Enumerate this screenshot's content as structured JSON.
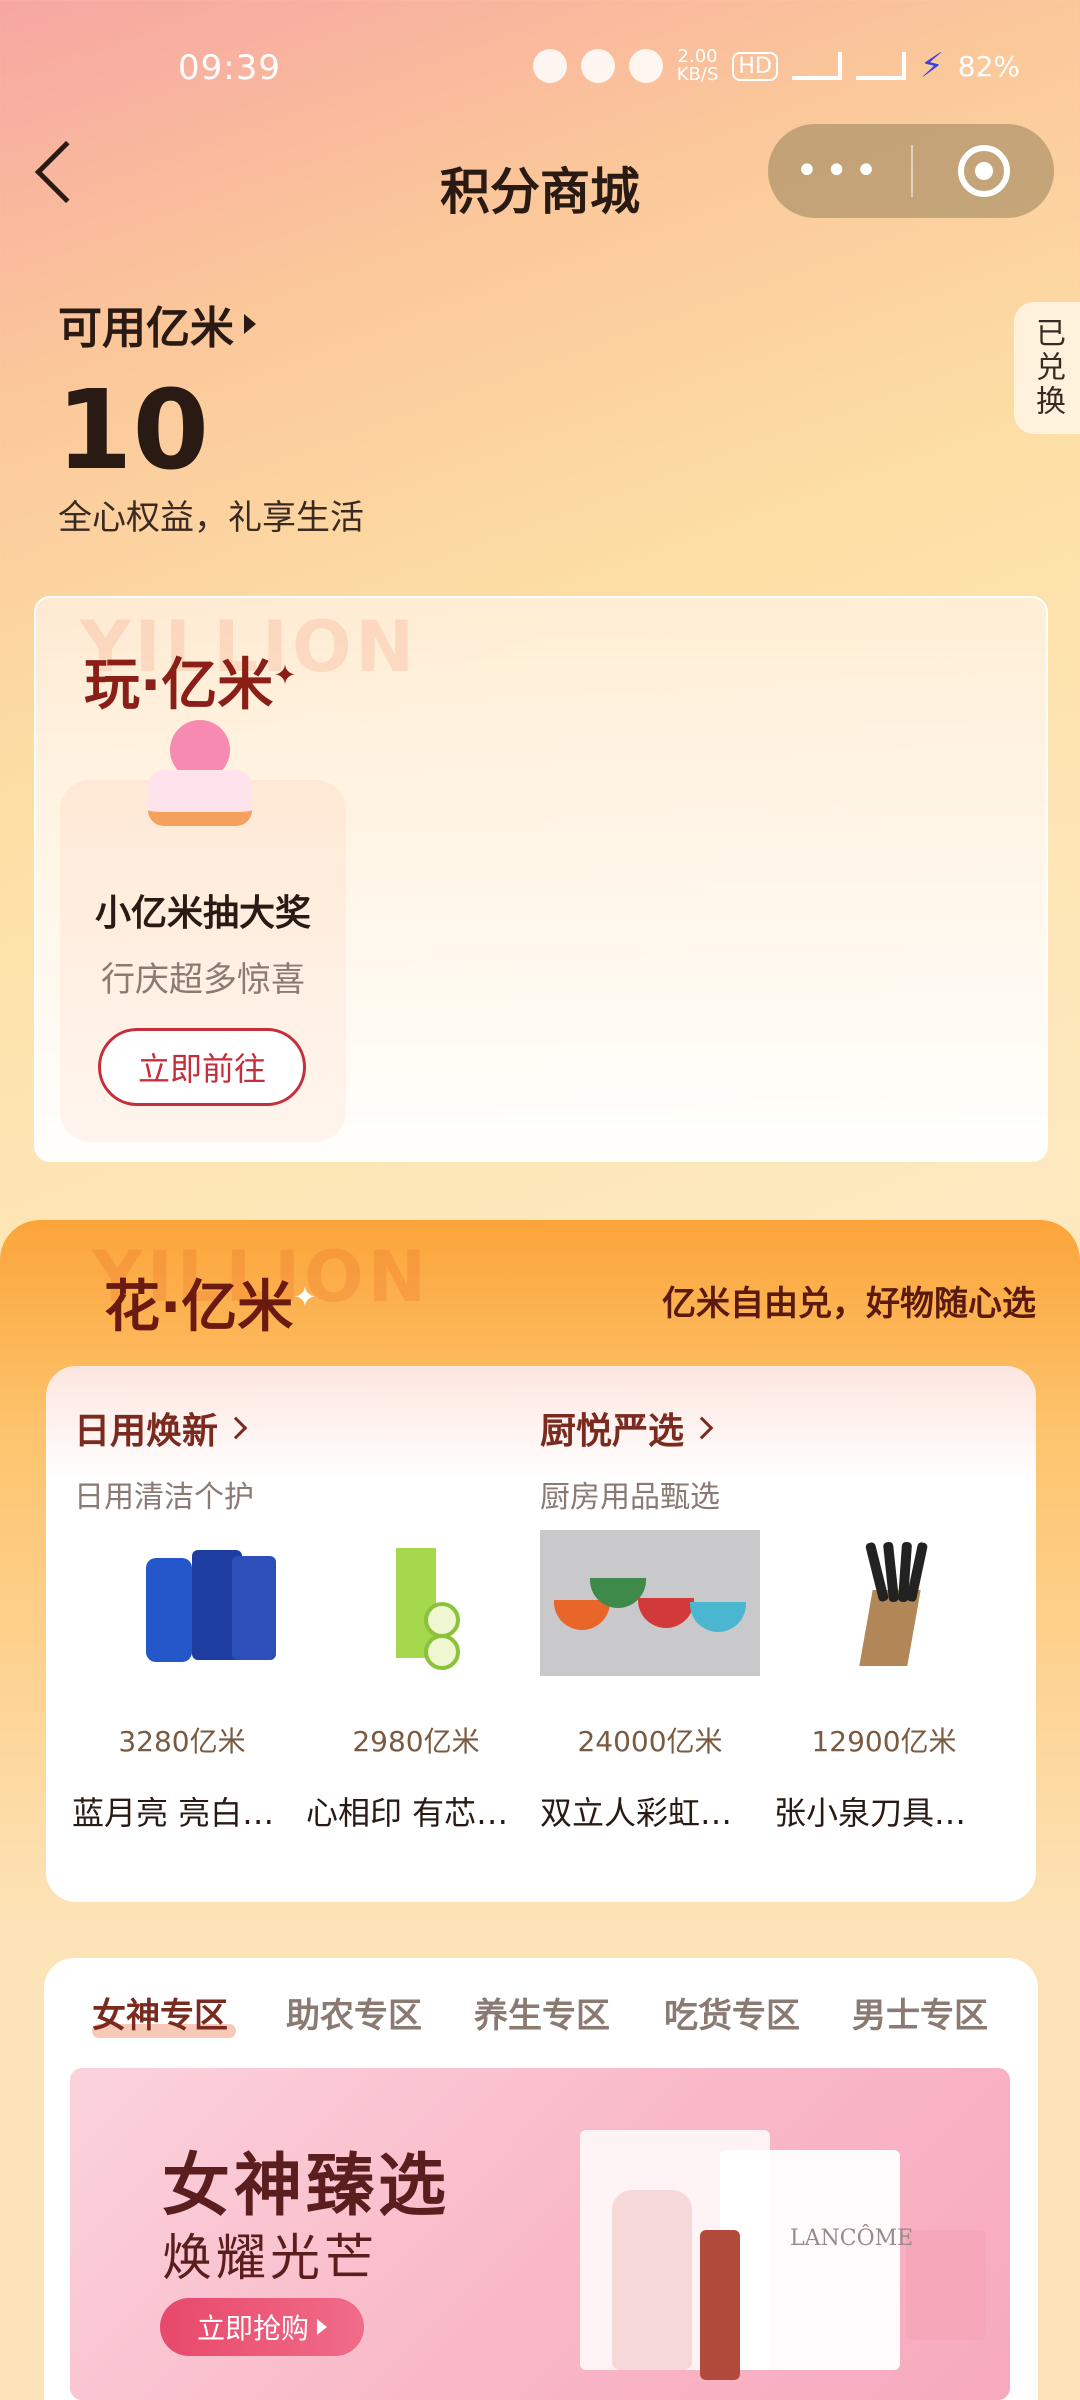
{
  "status_bar": {
    "time": "09:39",
    "speed": "2.00",
    "speed_unit": "KB/S",
    "hd": "HD",
    "battery": "82%"
  },
  "nav": {
    "title": "积分商城",
    "more_glyph": "•••"
  },
  "points": {
    "label": "可用亿米",
    "value": "10",
    "subtitle": "全心权益，礼享生活",
    "redeemed_tab": "已兑换"
  },
  "play_section": {
    "watermark": "YILLION",
    "title": "玩·亿米",
    "spark": "✦",
    "lottery": {
      "title": "小亿米抽大奖",
      "subtitle": "行庆超多惊喜",
      "button": "立即前往"
    }
  },
  "flower_section": {
    "watermark": "YILLION",
    "title": "花·亿米",
    "spark": "✦",
    "slogan": "亿米自由兑，好物随心选",
    "categories": [
      {
        "title": "日用焕新",
        "subtitle": "日用清洁个护"
      },
      {
        "title": "厨悦严选",
        "subtitle": "厨房用品甄选"
      }
    ],
    "products": [
      {
        "price": "3280亿米",
        "name": "蓝月亮 亮白…"
      },
      {
        "price": "2980亿米",
        "name": "心相印 有芯…"
      },
      {
        "price": "24000亿米",
        "name": "双立人彩虹…"
      },
      {
        "price": "12900亿米",
        "name": "张小泉刀具…"
      }
    ]
  },
  "zones": {
    "tabs": [
      "女神专区",
      "助农专区",
      "养生专区",
      "吃货专区",
      "男士专区"
    ],
    "active_tab": "女神专区",
    "banner": {
      "title": "女神臻选",
      "subtitle": "焕耀光芒",
      "button": "立即抢购",
      "brand_text": "LANCÔME"
    }
  },
  "colors": {
    "accent_red": "#c72e3b",
    "brand_brown": "#7a2a1e",
    "flower_orange": "#fca43a"
  }
}
